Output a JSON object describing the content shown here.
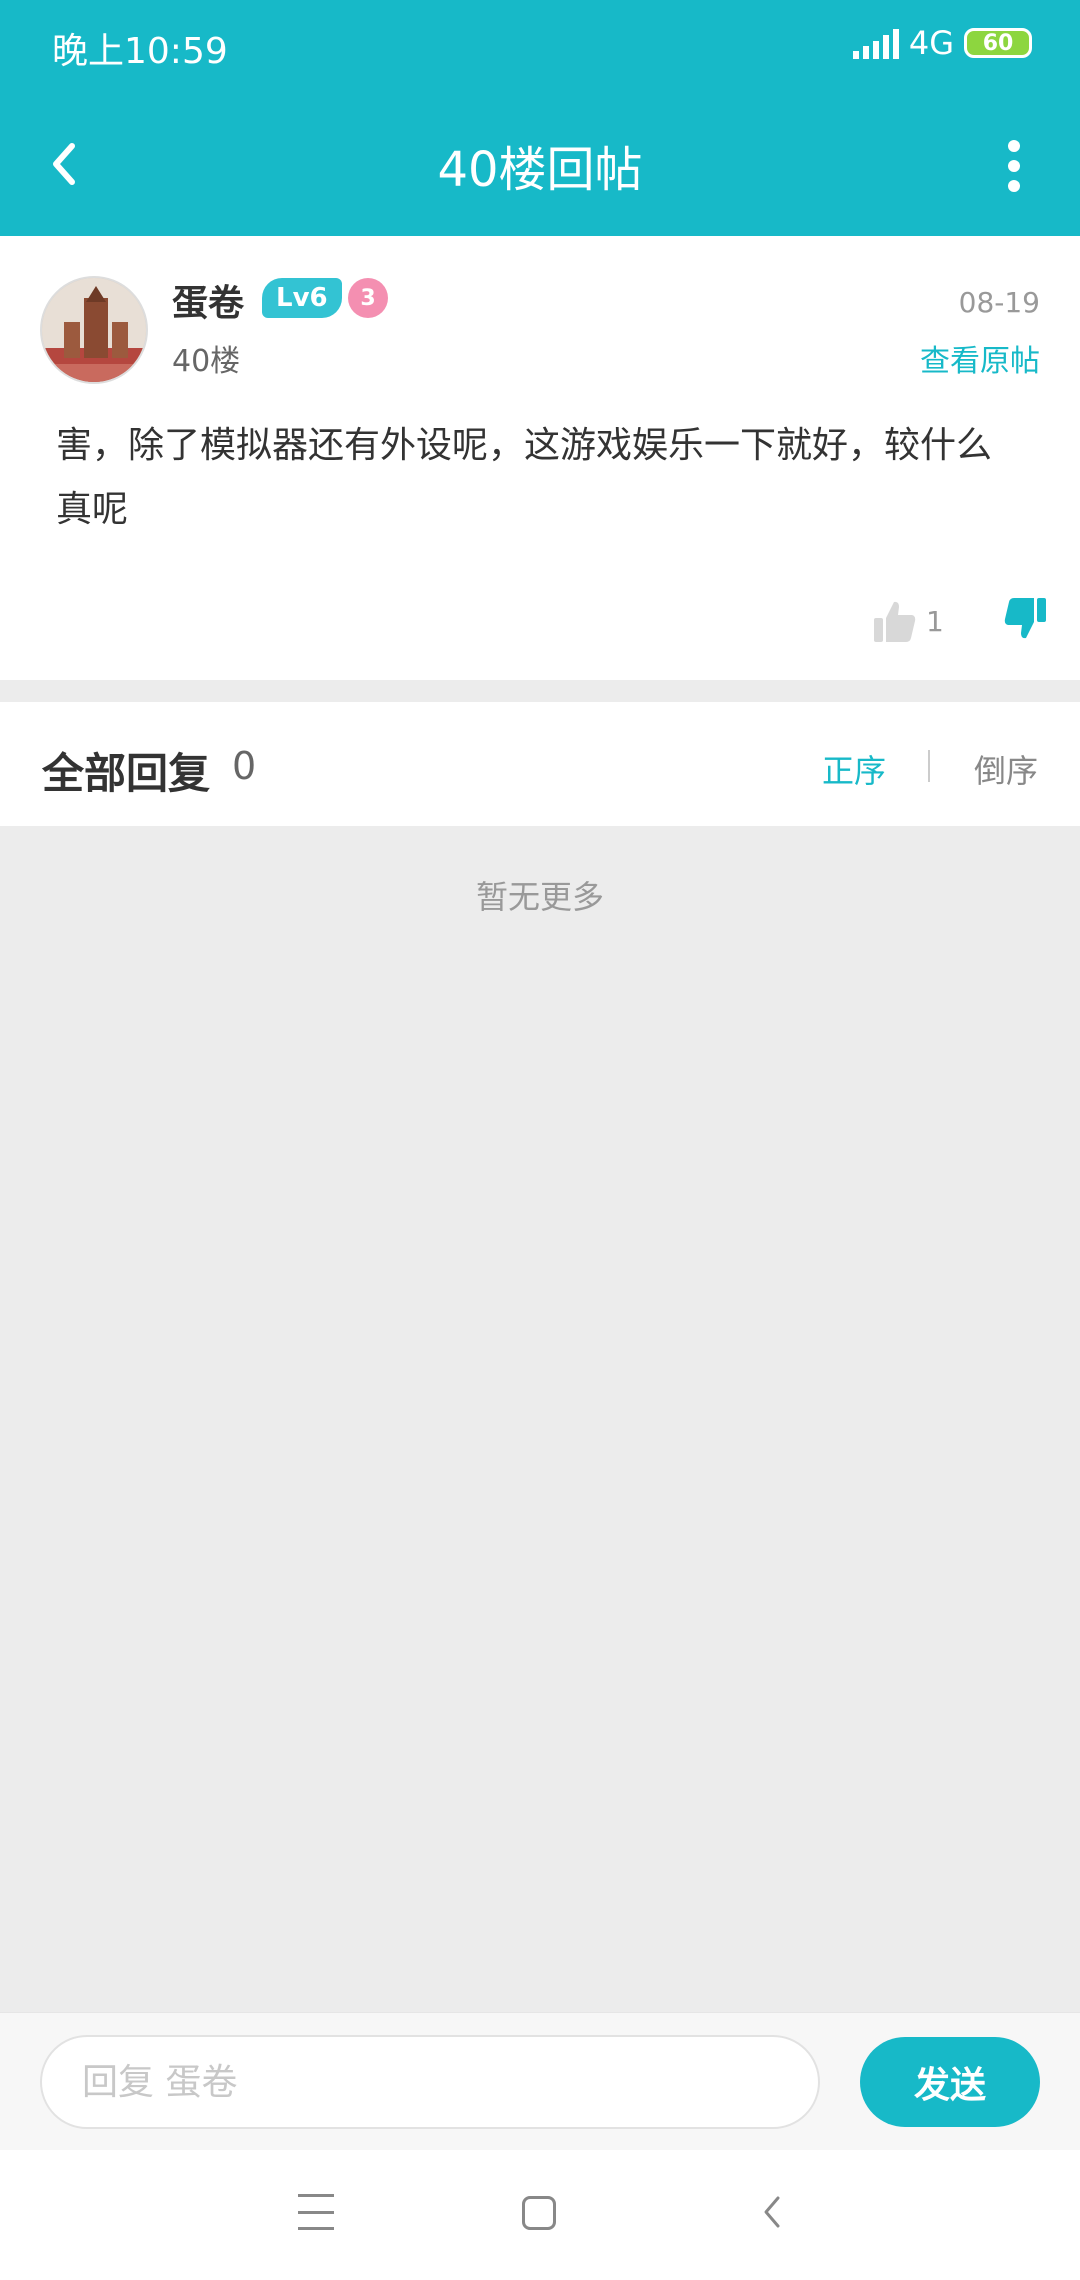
{
  "status_bar": {
    "time": "晚上10:59",
    "network": "4G",
    "battery": "60"
  },
  "header": {
    "title": "40楼回帖",
    "back_icon": "back-arrow-icon",
    "more_icon": "more-vertical-icon"
  },
  "post": {
    "username": "蛋卷",
    "level": "Lv6",
    "medal": "3",
    "floor": "40楼",
    "date": "08-19",
    "view_original": "查看原帖",
    "content": "害，除了模拟器还有外设呢，这游戏娱乐一下就好，较什么真呢",
    "likes": "1"
  },
  "replies": {
    "title": "全部回复",
    "count": "0",
    "sort_asc": "正序",
    "sort_desc": "倒序",
    "empty": "暂无更多"
  },
  "reply_bar": {
    "placeholder": "回复 蛋卷",
    "send": "发送"
  },
  "colors": {
    "accent": "#17b9c8",
    "background": "#ececec"
  }
}
